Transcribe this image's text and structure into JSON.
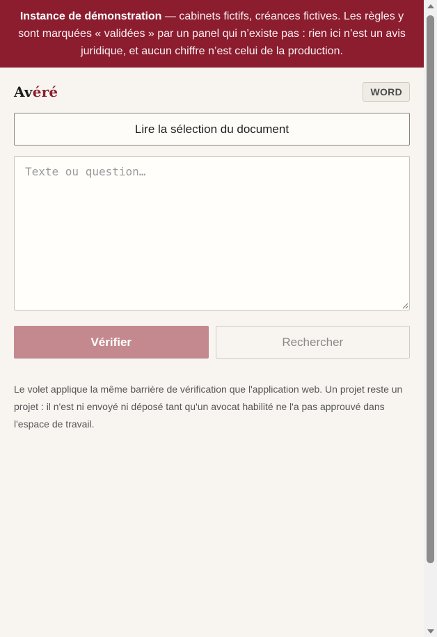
{
  "banner": {
    "strong": "Instance de démonstration",
    "rest": " — cabinets fictifs, créances fictives. Les règles y sont marquées « validées » par un panel qui n’existe pas : rien ici n’est un avis juridique, et aucun chiffre n’est celui de la production."
  },
  "header": {
    "brand_a": "Av",
    "brand_b": "é",
    "brand_c": "ré",
    "badge": "WORD"
  },
  "read_button": "Lire la sélection du document",
  "input": {
    "placeholder": "Texte ou question…",
    "value": ""
  },
  "actions": {
    "verify": "Vérifier",
    "search": "Rechercher"
  },
  "note": "Le volet applique la même barrière de vérification que l'application web. Un projet reste un projet : il n'est ni envoyé ni déposé tant qu'un avocat habilité ne l'a pas approuvé dans l'espace de travail.",
  "colors": {
    "brand": "#8b1d2f",
    "verify_disabled": "#c4898e",
    "background": "#f8f5f0"
  }
}
